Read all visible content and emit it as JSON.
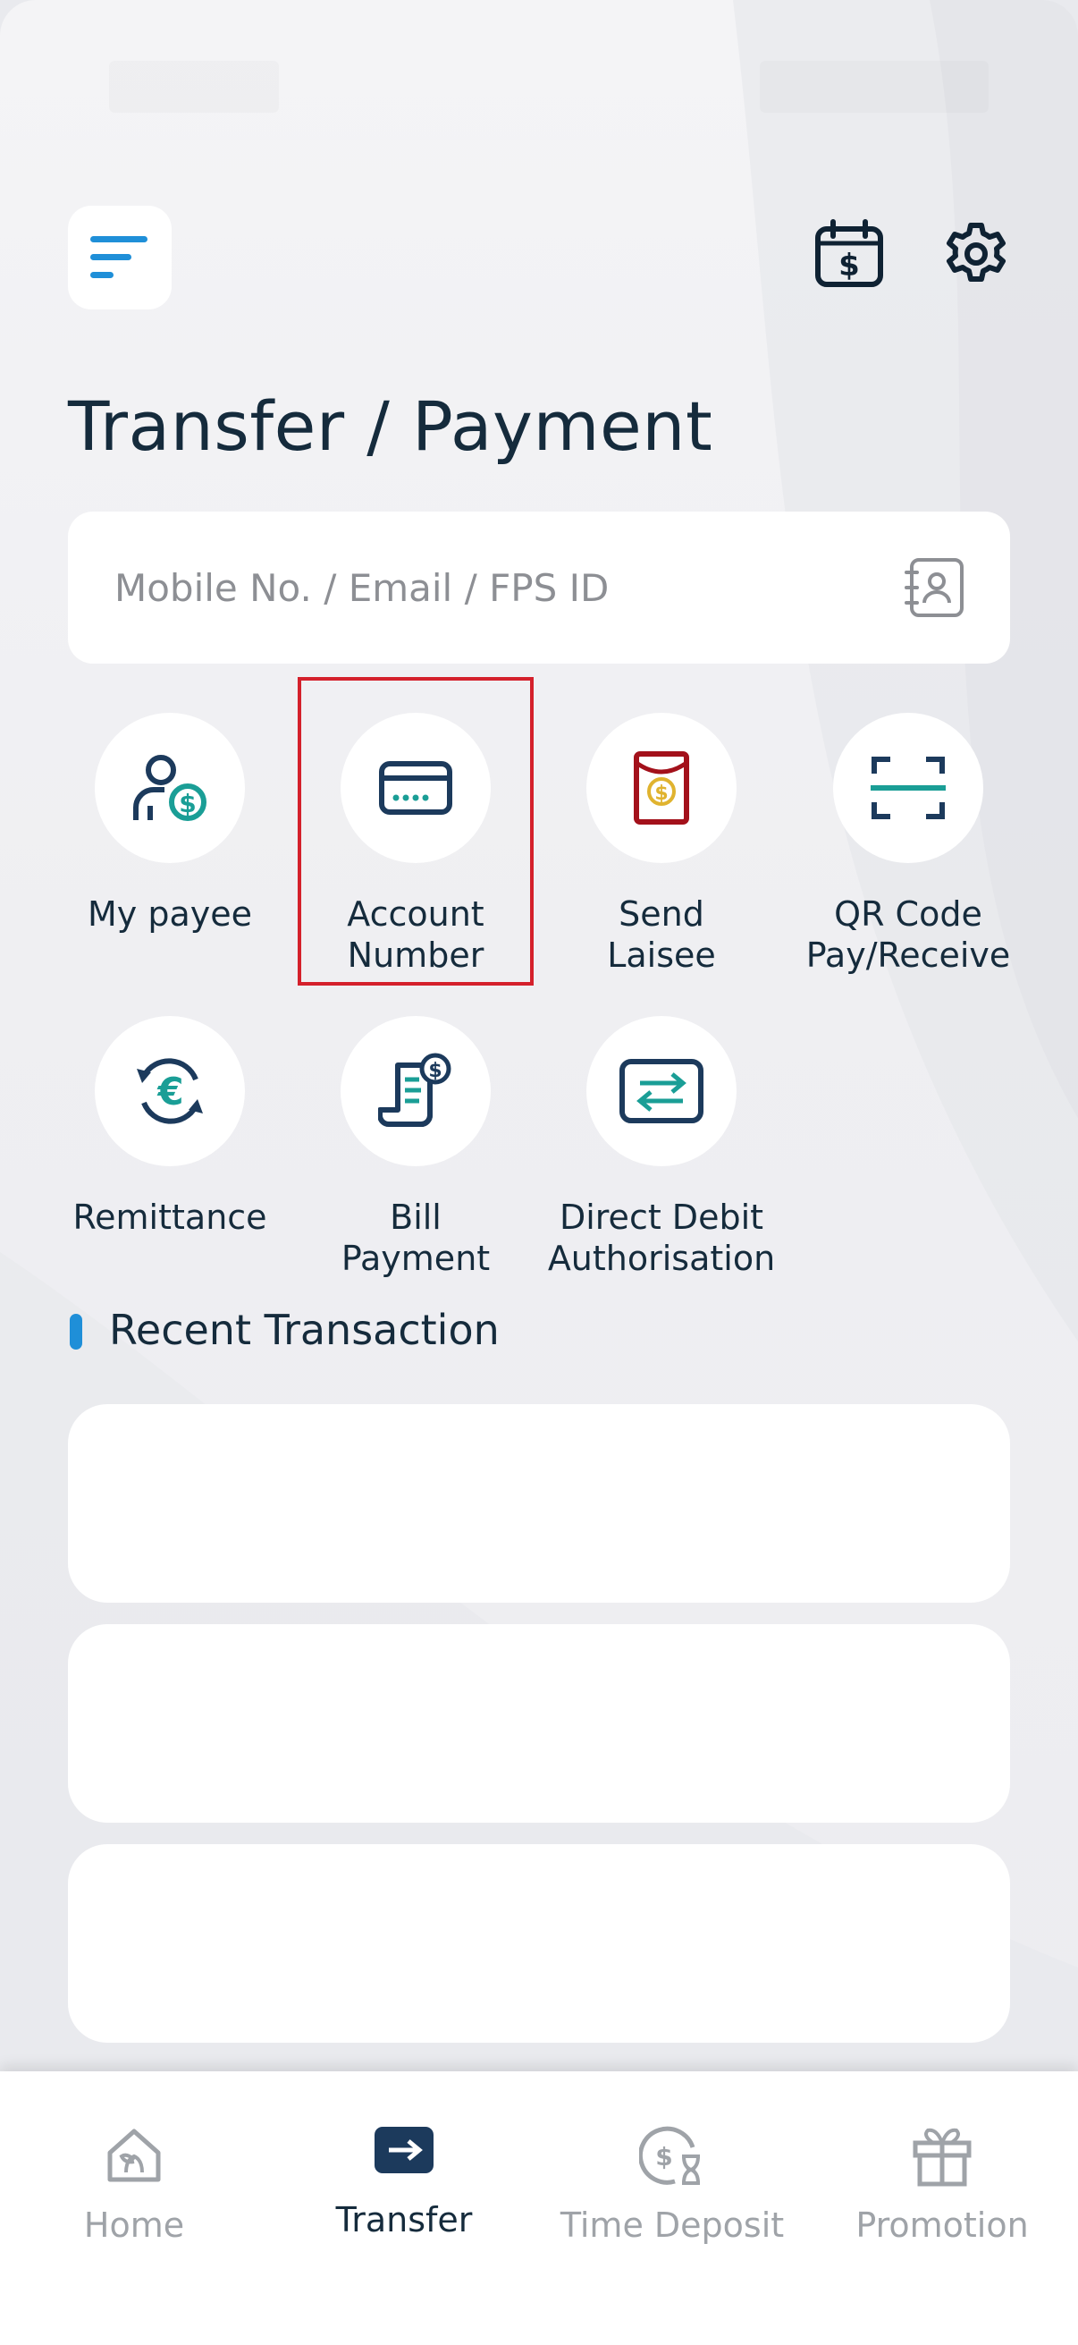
{
  "header": {
    "title": "Transfer / Payment",
    "menu_icon": "menu-lines-icon",
    "icons": [
      "calendar-dollar-icon",
      "gear-icon"
    ]
  },
  "search": {
    "placeholder": "Mobile No. / Email / FPS ID",
    "value": "",
    "icon": "contact-book-icon"
  },
  "quick_actions": [
    {
      "label_line1": "My payee",
      "label_line2": "",
      "icon": "person-dollar-icon"
    },
    {
      "label_line1": "Account",
      "label_line2": "Number",
      "icon": "card-icon",
      "highlighted": true
    },
    {
      "label_line1": "Send",
      "label_line2": "Laisee",
      "icon": "red-packet-icon"
    },
    {
      "label_line1": "QR Code",
      "label_line2": "Pay/Receive",
      "icon": "qr-scan-icon"
    },
    {
      "label_line1": "Remittance",
      "label_line2": "",
      "icon": "euro-exchange-icon"
    },
    {
      "label_line1": "Bill",
      "label_line2": "Payment",
      "icon": "bill-receipt-icon"
    },
    {
      "label_line1": "Direct Debit",
      "label_line2": "Authorisation",
      "icon": "transfer-arrows-icon"
    }
  ],
  "recent": {
    "title": "Recent Transaction",
    "cards": 3
  },
  "bottom_nav": [
    {
      "label": "Home",
      "icon": "home-icon",
      "active": false
    },
    {
      "label": "Transfer",
      "icon": "transfer-arrow-icon",
      "active": true
    },
    {
      "label": "Time Deposit",
      "icon": "time-deposit-icon",
      "active": false
    },
    {
      "label": "Promotion",
      "icon": "gift-icon",
      "active": false
    }
  ],
  "colors": {
    "primary_text": "#152b3c",
    "accent_blue": "#1f8fd8",
    "teal": "#1a9e96",
    "highlight_red": "#d4202b",
    "inactive_nav": "#9fa3a8"
  }
}
